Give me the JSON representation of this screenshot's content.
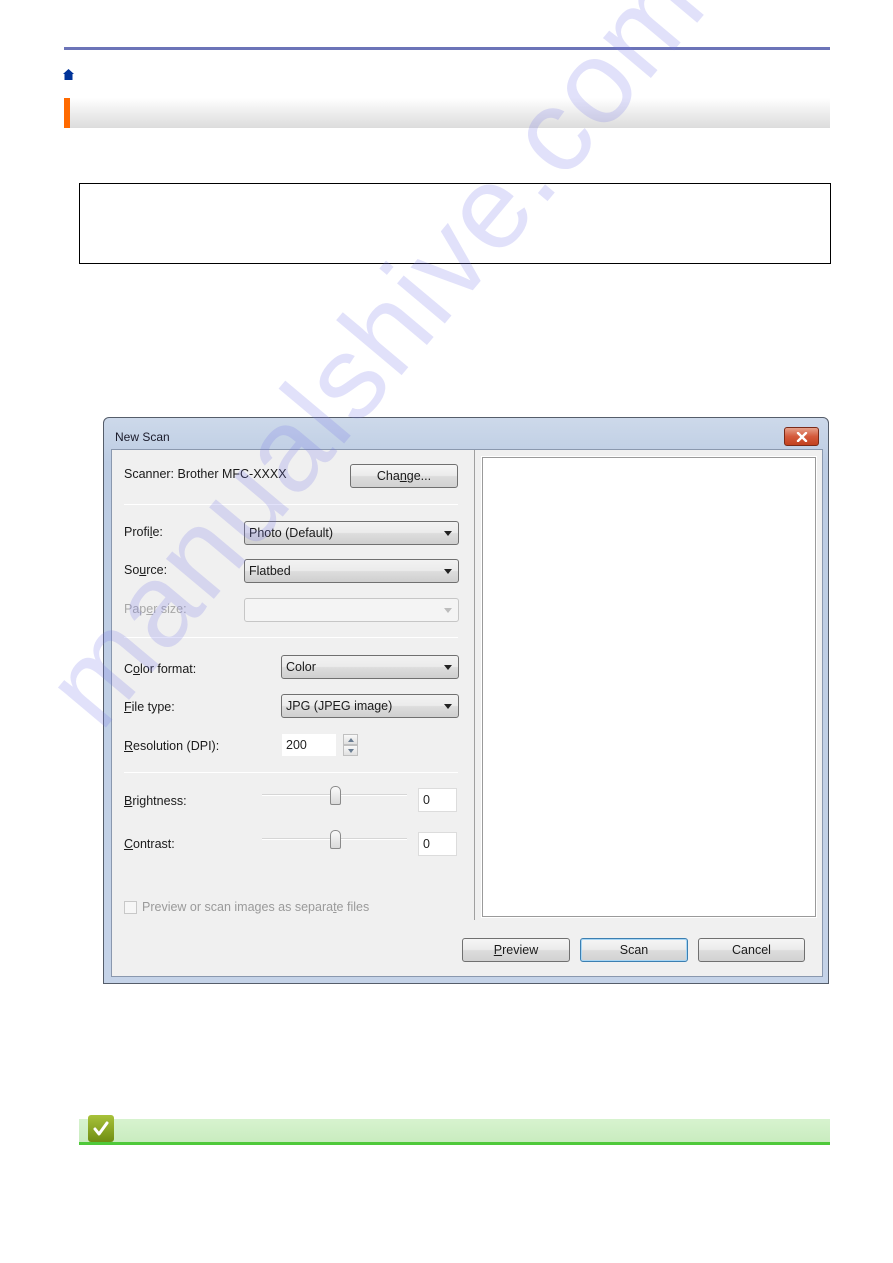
{
  "page": {
    "colors": {
      "top_rule": "#6c74b8",
      "home_icon": "#003399",
      "section_accent": "#ff6a00",
      "tip_accent": "#4fc93a",
      "tip_icon": "#8aa723"
    },
    "home_icon": "home-icon",
    "tip_icon": "checkmark-icon"
  },
  "dialog": {
    "title": "New Scan",
    "close_icon": "close-icon",
    "scanner_label": "Scanner: Brother MFC-XXXX",
    "change_button": {
      "pre": "Cha",
      "accel": "n",
      "post": "ge..."
    },
    "profile": {
      "label_pre": "Profi",
      "label_accel": "l",
      "label_post": "e:",
      "value": "Photo (Default)"
    },
    "source": {
      "label_pre": "So",
      "label_accel": "u",
      "label_post": "rce:",
      "value": "Flatbed"
    },
    "paper_size": {
      "label_pre": "Pap",
      "label_accel": "e",
      "label_post": "r size:",
      "value": "",
      "disabled": true
    },
    "color_format": {
      "label_pre": "C",
      "label_accel": "o",
      "label_post": "lor format:",
      "value": "Color"
    },
    "file_type": {
      "label_pre": "",
      "label_accel": "F",
      "label_post": "ile type:",
      "value": "JPG (JPEG image)"
    },
    "resolution": {
      "label_pre": "",
      "label_accel": "R",
      "label_post": "esolution (DPI):",
      "value": "200"
    },
    "brightness": {
      "label_pre": "",
      "label_accel": "B",
      "label_post": "rightness:",
      "value": "0"
    },
    "contrast": {
      "label_pre": "",
      "label_accel": "C",
      "label_post": "ontrast:",
      "value": "0"
    },
    "separate_files": {
      "label_pre": "Preview or scan images as separa",
      "label_accel": "t",
      "label_post": "e files",
      "checked": false,
      "disabled": true
    },
    "buttons": {
      "preview": {
        "pre": "",
        "accel": "P",
        "post": "review"
      },
      "scan": "Scan",
      "cancel": "Cancel"
    }
  },
  "watermark": "manualshive.com"
}
